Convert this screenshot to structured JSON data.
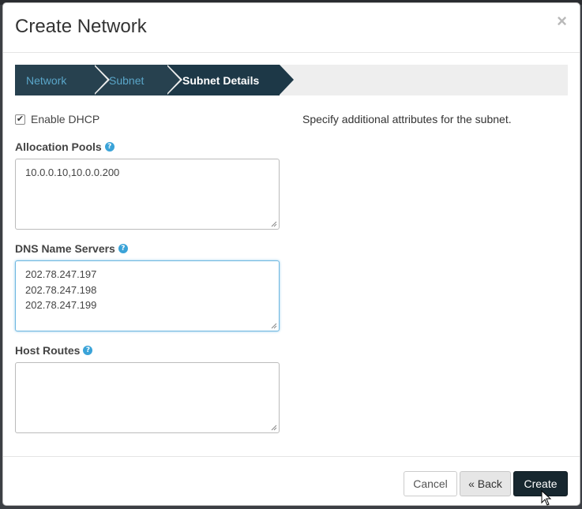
{
  "modal": {
    "title": "Create Network",
    "close_label": "×"
  },
  "wizard": {
    "steps": [
      {
        "label": "Network",
        "state": "done"
      },
      {
        "label": "Subnet",
        "state": "done"
      },
      {
        "label": "Subnet Details",
        "state": "active"
      }
    ]
  },
  "form": {
    "enable_dhcp": {
      "label": "Enable DHCP",
      "checked": true,
      "check_glyph": "✔"
    },
    "allocation_pools": {
      "label": "Allocation Pools",
      "value": "10.0.0.10,10.0.0.200"
    },
    "dns_name_servers": {
      "label": "DNS Name Servers",
      "value": "202.78.247.197\n202.78.247.198\n202.78.247.199"
    },
    "host_routes": {
      "label": "Host Routes",
      "value": ""
    },
    "help_glyph": "?"
  },
  "help_text": "Specify additional attributes for the subnet.",
  "footer": {
    "cancel_label": "Cancel",
    "back_label": "« Back",
    "create_label": "Create"
  },
  "colors": {
    "step_done_bg": "#27414f",
    "step_active_bg": "#1d3847",
    "step_done_text": "#5aa6c9",
    "help_icon": "#3aa3d8",
    "primary_button": "#17272f"
  }
}
